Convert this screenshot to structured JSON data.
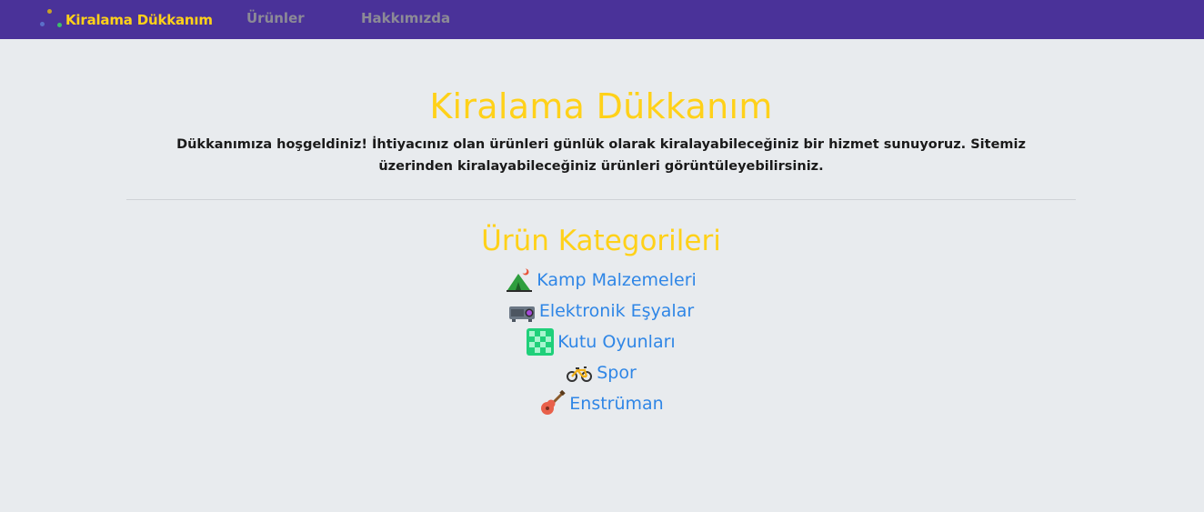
{
  "navbar": {
    "brand": "Kiralama Dükkanım",
    "links": [
      "Ürünler",
      "Hakkımızda"
    ]
  },
  "main": {
    "title": "Kiralama Dükkanım",
    "intro": "Dükkanımıza hoşgeldiniz! İhtiyacınız olan ürünleri günlük olarak kiralayabileceğiniz bir hizmet sunuyoruz. Sitemiz üzerinden kiralayabileceğiniz ürünleri görüntüleyebilirsiniz.",
    "categories_title": "Ürün Kategorileri",
    "categories": [
      {
        "label": "Kamp Malzemeleri",
        "icon": "tent-icon"
      },
      {
        "label": "Elektronik Eşyalar",
        "icon": "projector-icon"
      },
      {
        "label": "Kutu Oyunları",
        "icon": "checkerboard-icon"
      },
      {
        "label": "Spor",
        "icon": "bicycle-icon"
      },
      {
        "label": "Enstrüman",
        "icon": "guitar-icon"
      }
    ]
  },
  "colors": {
    "navbar_bg": "#4a3299",
    "accent_yellow": "#ffd119",
    "link_blue": "#2f86e6",
    "page_bg": "#e8ebee"
  }
}
